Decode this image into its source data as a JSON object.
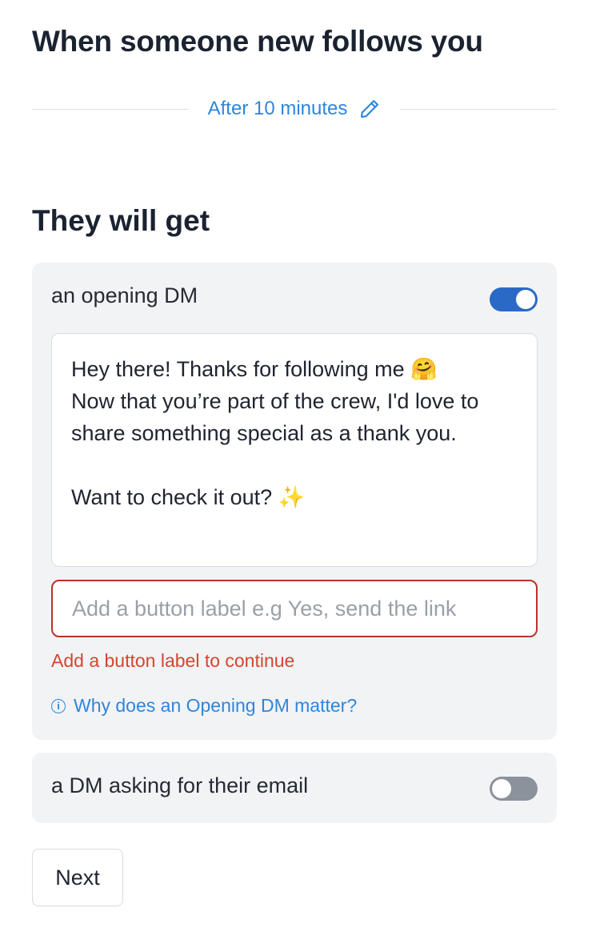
{
  "header": {
    "title": "When someone new follows you"
  },
  "delay": {
    "label": "After 10 minutes",
    "icon": "pencil-icon",
    "color": "#2d86de"
  },
  "section": {
    "title": "They will get"
  },
  "opening_dm": {
    "label": "an opening DM",
    "enabled": true,
    "message": "Hey there! Thanks for following me 🤗\nNow that you’re part of the crew, I'd love to share something special as a thank you.\n\nWant to check it out? ✨",
    "button_label_value": "",
    "button_label_placeholder": "Add a button label e.g Yes, send the link",
    "error": "Add a button label to continue",
    "error_color": "#d64530",
    "help_link": "Why does an Opening DM matter?",
    "help_icon": "info-icon",
    "help_icon_glyph": "i"
  },
  "email_dm": {
    "label": "a DM asking for their email",
    "enabled": false
  },
  "footer": {
    "next_label": "Next"
  },
  "colors": {
    "accent": "#2d86de",
    "toggle_on": "#2a6ac6",
    "toggle_off": "#8b929c",
    "error": "#d64530",
    "card_bg": "#f2f3f5"
  }
}
